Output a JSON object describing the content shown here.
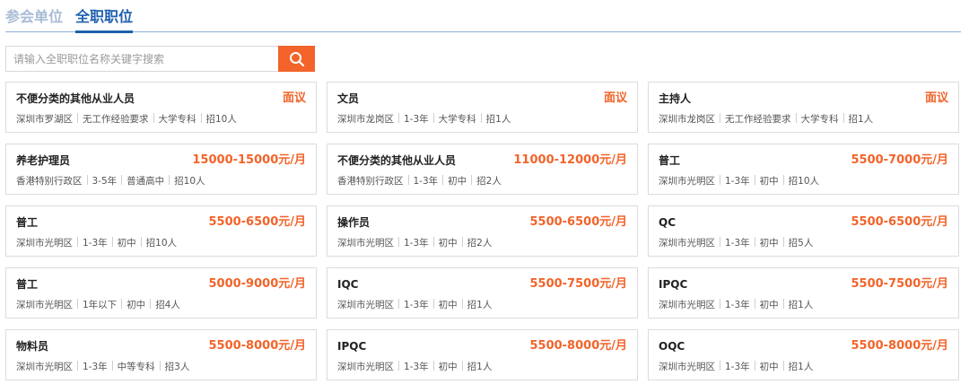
{
  "tabs": {
    "units_label": "参会单位",
    "fulltime_label": "全职职位"
  },
  "search": {
    "placeholder": "请输入全职职位名称关键字搜索",
    "button_icon": "search-icon"
  },
  "colors": {
    "accent": "#f2642a",
    "tab_active": "#1f5fae",
    "tab_inactive": "#a9bcd6"
  },
  "jobs": [
    {
      "title": "不便分类的其他从业人员",
      "salary": "面议",
      "location": "深圳市罗湖区",
      "experience": "无工作经验要求",
      "education": "大学专科",
      "count": "招10人"
    },
    {
      "title": "文员",
      "salary": "面议",
      "location": "深圳市龙岗区",
      "experience": "1-3年",
      "education": "大学专科",
      "count": "招1人"
    },
    {
      "title": "主持人",
      "salary": "面议",
      "location": "深圳市龙岗区",
      "experience": "无工作经验要求",
      "education": "大学专科",
      "count": "招1人"
    },
    {
      "title": "养老护理员",
      "salary": "15000-15000元/月",
      "location": "香港特别行政区",
      "experience": "3-5年",
      "education": "普通高中",
      "count": "招10人"
    },
    {
      "title": "不便分类的其他从业人员",
      "salary": "11000-12000元/月",
      "location": "香港特别行政区",
      "experience": "1-3年",
      "education": "初中",
      "count": "招2人"
    },
    {
      "title": "普工",
      "salary": "5500-7000元/月",
      "location": "深圳市光明区",
      "experience": "1-3年",
      "education": "初中",
      "count": "招10人"
    },
    {
      "title": "普工",
      "salary": "5500-6500元/月",
      "location": "深圳市光明区",
      "experience": "1-3年",
      "education": "初中",
      "count": "招10人"
    },
    {
      "title": "操作员",
      "salary": "5500-6500元/月",
      "location": "深圳市光明区",
      "experience": "1-3年",
      "education": "初中",
      "count": "招2人"
    },
    {
      "title": "QC",
      "salary": "5500-6500元/月",
      "location": "深圳市光明区",
      "experience": "1-3年",
      "education": "初中",
      "count": "招5人"
    },
    {
      "title": "普工",
      "salary": "5000-9000元/月",
      "location": "深圳市光明区",
      "experience": "1年以下",
      "education": "初中",
      "count": "招4人"
    },
    {
      "title": "IQC",
      "salary": "5500-7500元/月",
      "location": "深圳市光明区",
      "experience": "1-3年",
      "education": "初中",
      "count": "招1人"
    },
    {
      "title": "IPQC",
      "salary": "5500-7500元/月",
      "location": "深圳市光明区",
      "experience": "1-3年",
      "education": "初中",
      "count": "招1人"
    },
    {
      "title": "物料员",
      "salary": "5500-8000元/月",
      "location": "深圳市光明区",
      "experience": "1-3年",
      "education": "中等专科",
      "count": "招3人"
    },
    {
      "title": "IPQC",
      "salary": "5500-8000元/月",
      "location": "深圳市光明区",
      "experience": "1-3年",
      "education": "初中",
      "count": "招1人"
    },
    {
      "title": "OQC",
      "salary": "5500-8000元/月",
      "location": "深圳市光明区",
      "experience": "1-3年",
      "education": "初中",
      "count": "招1人"
    }
  ]
}
